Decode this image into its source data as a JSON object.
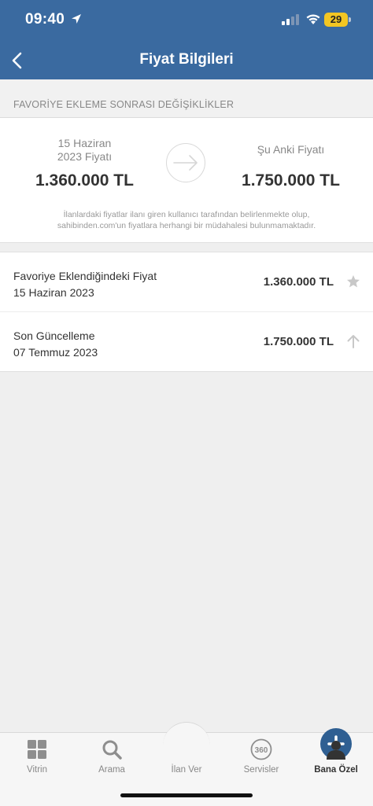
{
  "status_bar": {
    "time": "09:40",
    "battery": "29"
  },
  "header": {
    "title": "Fiyat Bilgileri"
  },
  "section": {
    "title": "FAVORİYE EKLEME SONRASI DEĞİŞİKLİKLER"
  },
  "comparison": {
    "old_label_line1": "15 Haziran",
    "old_label_line2": "2023 Fiyatı",
    "old_value": "1.360.000 TL",
    "new_label": "Şu Anki Fiyatı",
    "new_value": "1.750.000 TL",
    "disclaimer_line1": "İlanlardaki fiyatlar ilanı giren kullanıcı tarafından belirlenmekte olup,",
    "disclaimer_line2": "sahibinden.com'un fiyatlara herhangi bir müdahalesi bulunmamaktadır."
  },
  "rows": [
    {
      "title": "Favoriye Eklendiğindeki Fiyat",
      "date": "15 Haziran 2023",
      "price": "1.360.000 TL",
      "icon": "star-icon"
    },
    {
      "title": "Son Güncelleme",
      "date": "07 Temmuz 2023",
      "price": "1.750.000 TL",
      "icon": "arrow-up-icon"
    }
  ],
  "tabs": [
    {
      "label": "Vitrin",
      "icon": "grid-icon"
    },
    {
      "label": "Arama",
      "icon": "search-icon"
    },
    {
      "label": "İlan Ver",
      "icon": "plus-icon"
    },
    {
      "label": "Servisler",
      "icon": "360-icon"
    },
    {
      "label": "Bana Özel",
      "icon": "user-icon"
    }
  ],
  "colors": {
    "header_bg": "#3a6aa0",
    "fab": "#2f5f92",
    "battery": "#f3c623"
  }
}
